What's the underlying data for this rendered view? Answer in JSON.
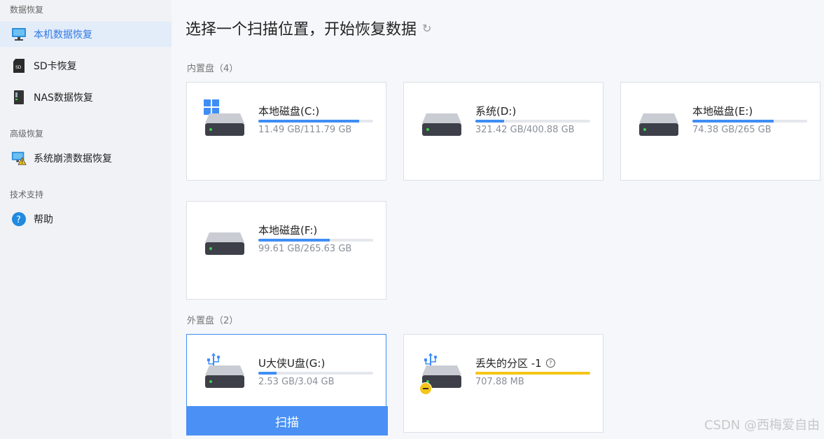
{
  "sidebar": {
    "sections": [
      {
        "label": "数据恢复"
      },
      {
        "label": "高级恢复"
      },
      {
        "label": "技术支持"
      }
    ],
    "items": [
      {
        "label": "本机数据恢复",
        "icon": "monitor-icon",
        "active": true
      },
      {
        "label": "SD卡恢复",
        "icon": "sd-card-icon"
      },
      {
        "label": "NAS数据恢复",
        "icon": "nas-icon"
      },
      {
        "label": "系统崩溃数据恢复",
        "icon": "system-crash-icon"
      },
      {
        "label": "帮助",
        "icon": "help-icon"
      }
    ]
  },
  "main": {
    "title": "选择一个扫描位置，开始恢复数据",
    "refresh_icon": "↻",
    "internal_label": "内置盘（4）",
    "external_label": "外置盘（2）",
    "internal_drives": [
      {
        "name": "本地磁盘(C:)",
        "size": "11.49 GB/111.79 GB",
        "used_fraction": 0.88,
        "icon": "windows-logo-icon"
      },
      {
        "name": "系统(D:)",
        "size": "321.42 GB/400.88 GB",
        "used_fraction": 0.25
      },
      {
        "name": "本地磁盘(E:)",
        "size": "74.38 GB/265 GB",
        "used_fraction": 0.71
      },
      {
        "name": "本地磁盘(F:)",
        "size": "99.61 GB/265.63 GB",
        "used_fraction": 0.62
      }
    ],
    "external_drives": [
      {
        "name": "U大侠U盘(G:)",
        "size": "2.53 GB/3.04 GB",
        "used_fraction": 0.16,
        "icon": "usb-icon",
        "selected": true
      },
      {
        "name": "丢失的分区 -1",
        "size": "707.88 MB",
        "used_fraction": 1.0,
        "icon": "usb-icon",
        "bar_color": "#f5c518"
      }
    ],
    "scan_label": "扫描"
  },
  "watermark": "CSDN @西梅爱自由",
  "colors": {
    "accent": "#3f8ef5",
    "lost_bar": "#f5c518",
    "sidebar_active_bg": "#e3ecf9"
  }
}
